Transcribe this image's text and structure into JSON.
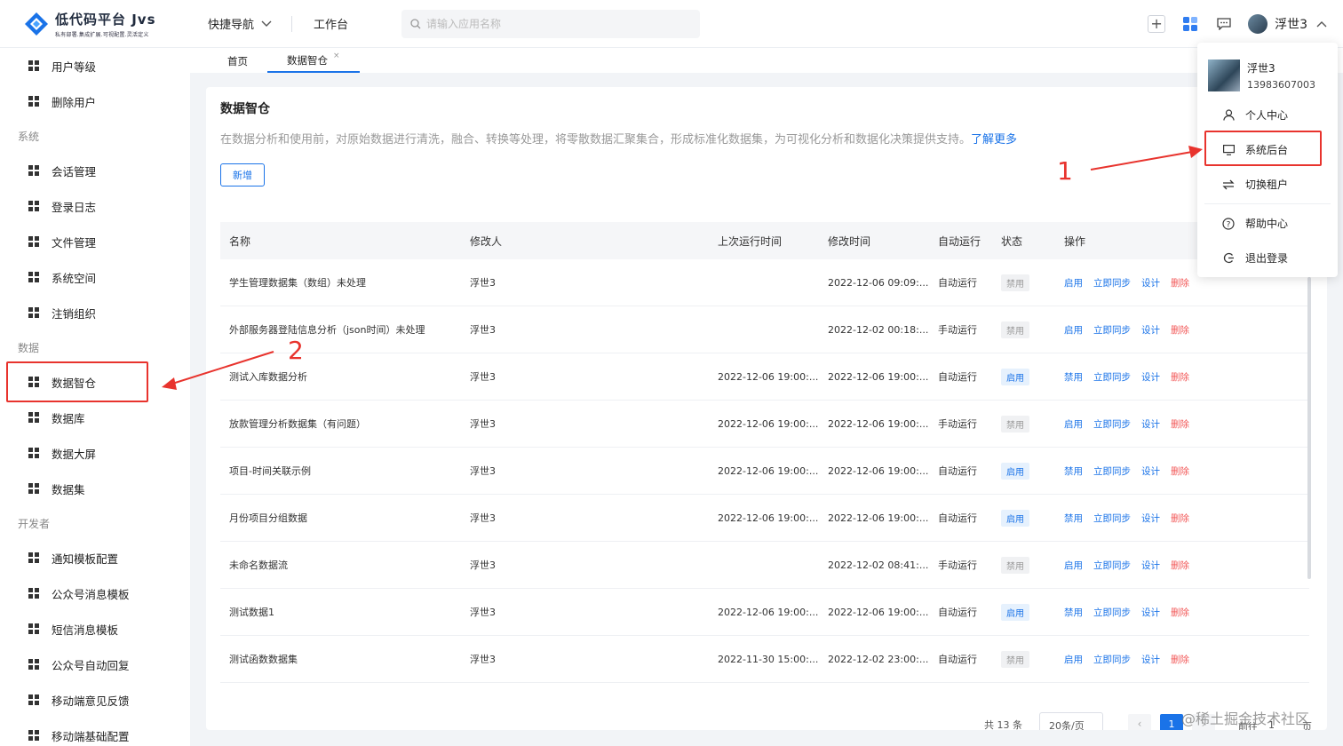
{
  "header": {
    "logo_title": "低代码平台 Jvs",
    "logo_sub": "私有部署.集成扩展.可视配置.灵活定义",
    "quick_nav": "快捷导航",
    "workbench": "工作台",
    "search_placeholder": "请输入应用名称",
    "user_name": "浮世3"
  },
  "sidebar": {
    "top_items": [
      "用户等级",
      "删除用户"
    ],
    "group_system": "系统",
    "system_items": [
      "会话管理",
      "登录日志",
      "文件管理",
      "系统空间",
      "注销组织"
    ],
    "group_data": "数据",
    "data_items": [
      "数据智仓",
      "数据库",
      "数据大屏",
      "数据集"
    ],
    "group_dev": "开发者",
    "dev_items": [
      "通知模板配置",
      "公众号消息模板",
      "短信消息模板",
      "公众号自动回复",
      "移动端意见反馈",
      "移动端基础配置"
    ]
  },
  "tabs": [
    {
      "label": "首页"
    },
    {
      "label": "数据智仓",
      "close": "×"
    }
  ],
  "main": {
    "title": "数据智仓",
    "description": "在数据分析和使用前，对原始数据进行清洗，融合、转换等处理，将零散数据汇聚集合，形成标准化数据集，为可视化分析和数据化决策提供支持。",
    "learn_more": "了解更多",
    "new_button": "新增"
  },
  "table": {
    "columns": [
      "名称",
      "修改人",
      "上次运行时间",
      "修改时间",
      "自动运行",
      "状态",
      "操作"
    ],
    "rows": [
      {
        "name": "学生管理数据集（数组）未处理",
        "modifier": "浮世3",
        "last_run": "",
        "modified": "2022-12-06 09:09:...",
        "run": "自动运行",
        "status": "禁用",
        "toggle": "启用"
      },
      {
        "name": "外部服务器登陆信息分析（json时间）未处理",
        "modifier": "浮世3",
        "last_run": "",
        "modified": "2022-12-02 00:18:...",
        "run": "手动运行",
        "status": "禁用",
        "toggle": "启用"
      },
      {
        "name": "测试入库数据分析",
        "modifier": "浮世3",
        "last_run": "2022-12-06 19:00:...",
        "modified": "2022-12-06 19:00:...",
        "run": "自动运行",
        "status": "启用",
        "toggle": "禁用"
      },
      {
        "name": "放款管理分析数据集（有问题）",
        "modifier": "浮世3",
        "last_run": "2022-12-06 19:00:...",
        "modified": "2022-12-06 19:00:...",
        "run": "手动运行",
        "status": "禁用",
        "toggle": "启用"
      },
      {
        "name": "项目-时间关联示例",
        "modifier": "浮世3",
        "last_run": "2022-12-06 19:00:...",
        "modified": "2022-12-06 19:00:...",
        "run": "自动运行",
        "status": "启用",
        "toggle": "禁用"
      },
      {
        "name": "月份项目分组数据",
        "modifier": "浮世3",
        "last_run": "2022-12-06 19:00:...",
        "modified": "2022-12-06 19:00:...",
        "run": "自动运行",
        "status": "启用",
        "toggle": "禁用"
      },
      {
        "name": "未命名数据流",
        "modifier": "浮世3",
        "last_run": "",
        "modified": "2022-12-02 08:41:...",
        "run": "手动运行",
        "status": "禁用",
        "toggle": "启用"
      },
      {
        "name": "测试数据1",
        "modifier": "浮世3",
        "last_run": "2022-12-06 19:00:...",
        "modified": "2022-12-06 19:00:...",
        "run": "自动运行",
        "status": "启用",
        "toggle": "禁用"
      },
      {
        "name": "测试函数数据集",
        "modifier": "浮世3",
        "last_run": "2022-11-30 15:00:...",
        "modified": "2022-12-02 23:00:...",
        "run": "自动运行",
        "status": "禁用",
        "toggle": "启用"
      }
    ],
    "op_sync": "立即同步",
    "op_design": "设计",
    "op_delete": "删除"
  },
  "pager": {
    "total": "共 13 条",
    "size": "20条/页",
    "current": "1",
    "goto": "前往",
    "goto_value": "1",
    "unit": "页"
  },
  "dropdown": {
    "name": "浮世3",
    "phone": "13983607003",
    "items": [
      "个人中心",
      "系统后台",
      "切换租户",
      "帮助中心",
      "退出登录"
    ]
  },
  "annotations": {
    "num1": "1",
    "num2": "2",
    "color": "#e8332d"
  },
  "watermark": "@稀土掘金技术社区",
  "colors": {
    "accent": "#1a73e8",
    "danger": "#f25858"
  }
}
